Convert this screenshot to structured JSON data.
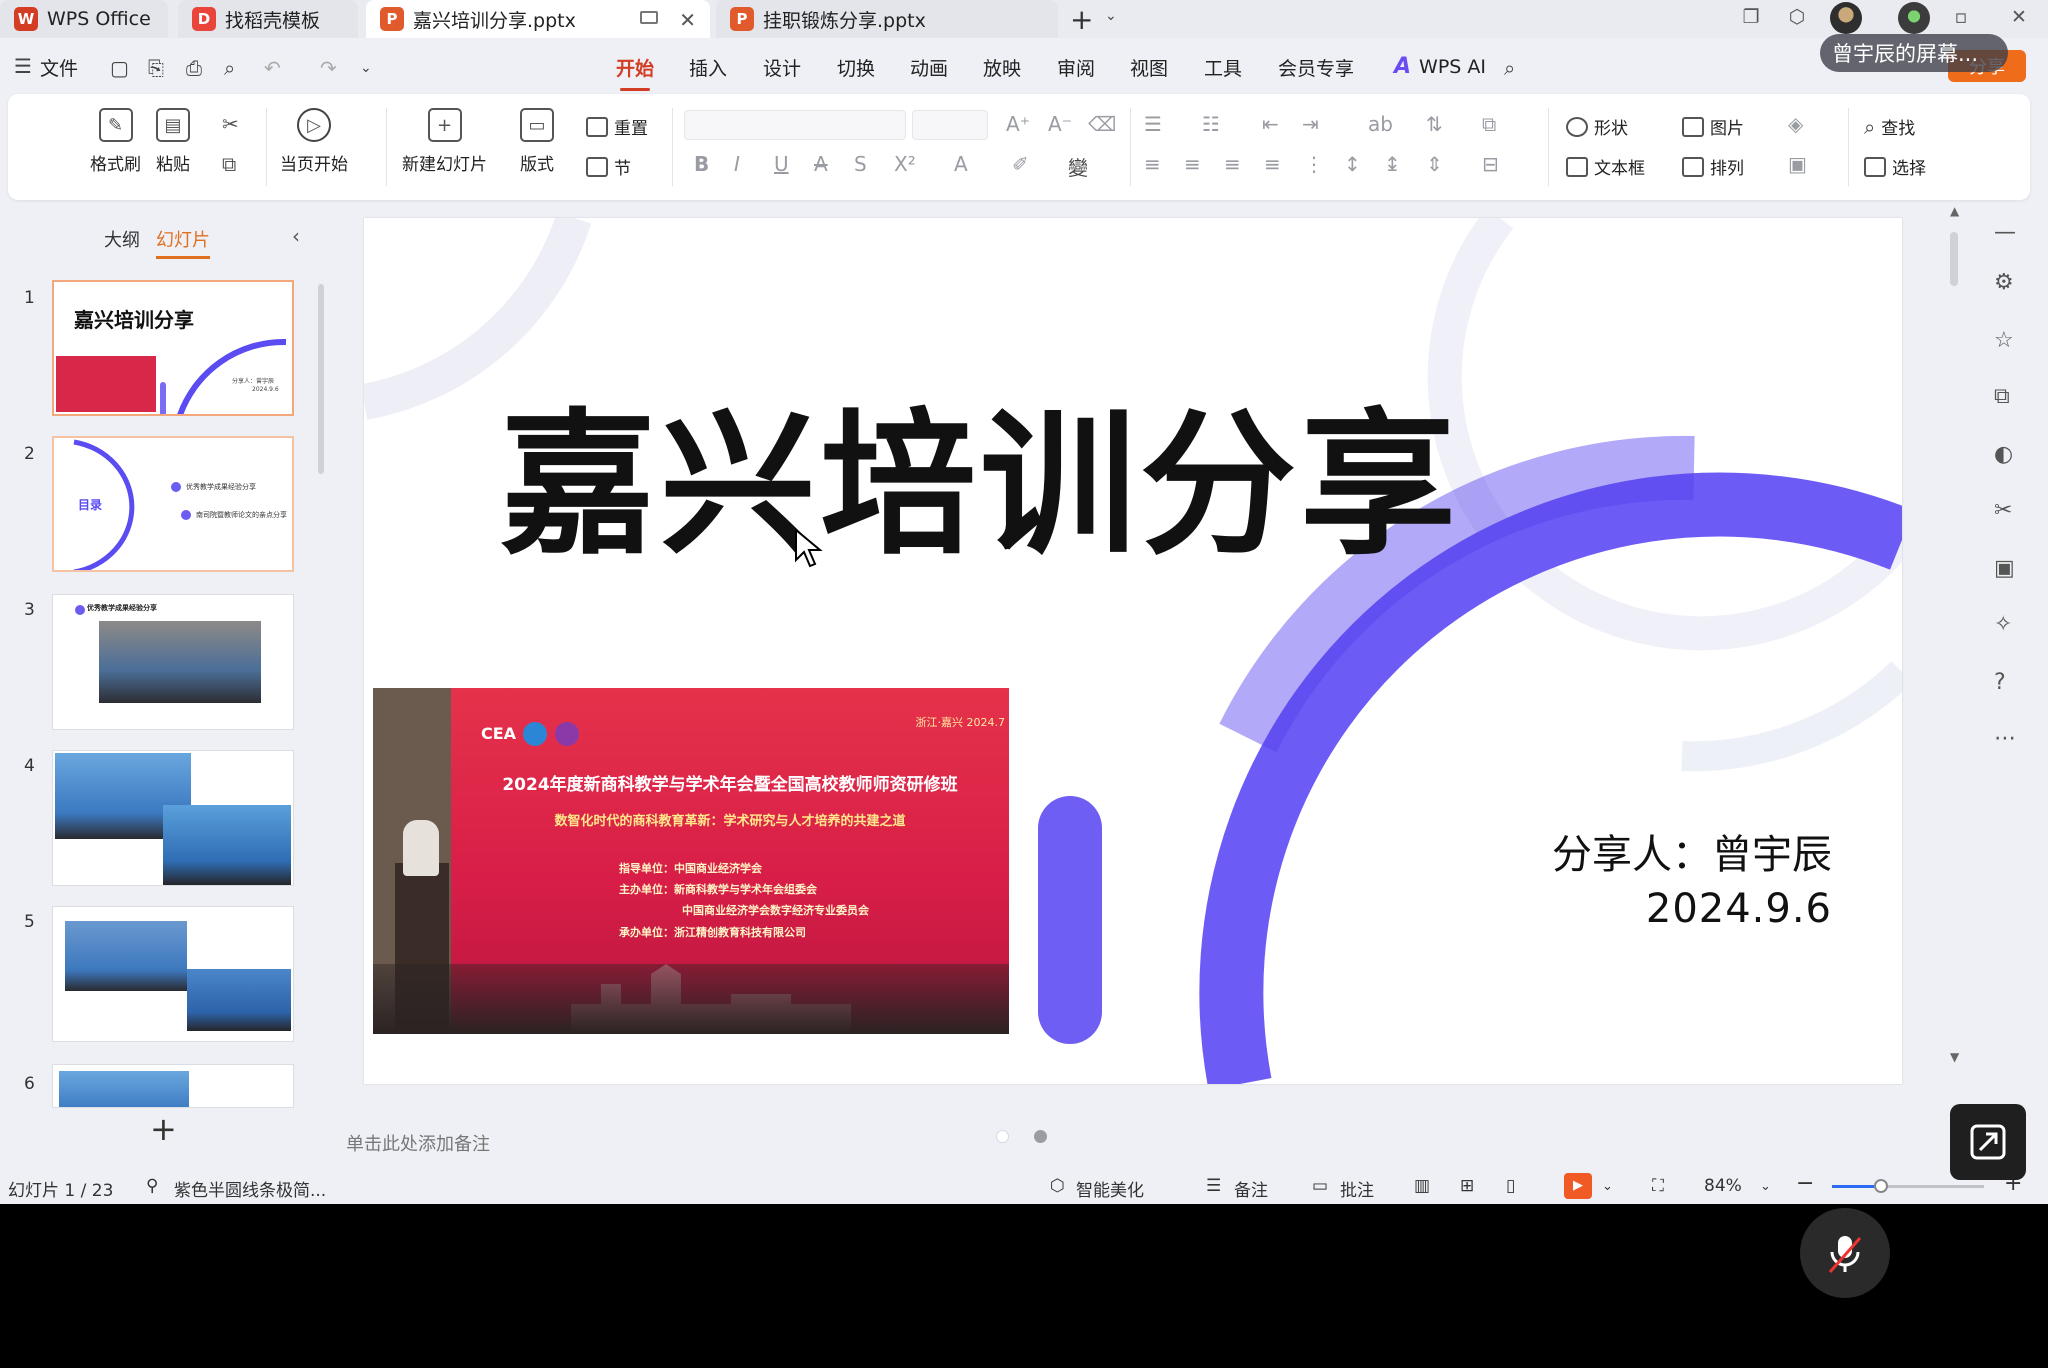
{
  "tabs": [
    {
      "label": "WPS Office"
    },
    {
      "label": "找稻壳模板"
    },
    {
      "label": "嘉兴培训分享.pptx"
    },
    {
      "label": "挂职锻炼分享.pptx"
    }
  ],
  "titlebar": {
    "share_overlay": "曾宇辰的屏幕..."
  },
  "menubar": {
    "file": "文件",
    "items": [
      "开始",
      "插入",
      "设计",
      "切换",
      "动画",
      "放映",
      "审阅",
      "视图",
      "工具",
      "会员专享"
    ],
    "active": "开始",
    "wps_ai": "WPS AI",
    "share": "分享"
  },
  "ribbon": {
    "format_painter": "格式刷",
    "paste": "粘贴",
    "from_current": "当页开始",
    "new_slide": "新建幻灯片",
    "layout": "版式",
    "reset": "重置",
    "section": "节",
    "shape": "形状",
    "picture": "图片",
    "find": "查找",
    "textbox": "文本框",
    "arrange": "排列",
    "select": "选择"
  },
  "leftpanel": {
    "tabs": [
      "大纲",
      "幻灯片"
    ],
    "active_tab": "幻灯片",
    "thumbs": [
      {
        "num": "1",
        "title": "嘉兴培训分享",
        "sub": "分享人：曾宇辰",
        "date": "2024.9.6"
      },
      {
        "num": "2",
        "title": "目录",
        "item1": "优秀教学成果经验分享",
        "item2": "南司院暨教师论文的亲点分享"
      },
      {
        "num": "3",
        "title": "优秀教学成果经验分享"
      },
      {
        "num": "4"
      },
      {
        "num": "5"
      },
      {
        "num": "6"
      }
    ]
  },
  "slide": {
    "title": "嘉兴培训分享",
    "sharer": "分享人：曾宇辰",
    "date": "2024.9.6",
    "photo": {
      "cea": "CEA",
      "location": "浙江·嘉兴 2024.7",
      "banner_title": "2024年度新商科教学与学术年会暨全国高校教师师资研修班",
      "banner_sub": "数智化时代的商科教育革新：学术研究与人才培养的共建之道",
      "lines": [
        "指导单位：中国商业经济学会",
        "主办单位：新商科教学与学术年会组委会",
        "中国商业经济学会数字经济专业委员会",
        "承办单位：浙江精创教育科技有限公司"
      ]
    }
  },
  "notes_placeholder": "单击此处添加备注",
  "statusbar": {
    "slide_counter": "幻灯片 1 / 23",
    "theme": "紫色半圆线条极简...",
    "smart_beautify": "智能美化",
    "notes": "备注",
    "comments": "批注",
    "zoom": "84%",
    "zoom_fraction": 0.84
  },
  "colors": {
    "accent": "#d23d24",
    "purple": "#5b4cf2",
    "orange": "#ef6c1b"
  }
}
